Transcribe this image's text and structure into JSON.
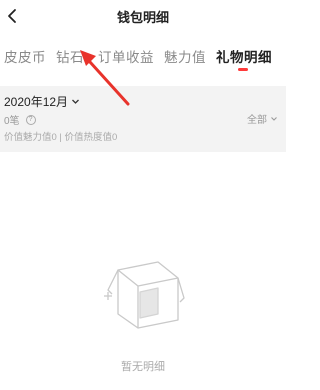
{
  "header": {
    "title": "钱包明细",
    "back_icon": "chevron-left-icon"
  },
  "tabs": [
    {
      "label": "皮皮币"
    },
    {
      "label": "钻石"
    },
    {
      "label": "订单收益"
    },
    {
      "label": "魅力值"
    },
    {
      "label": "礼物明细",
      "active": true
    }
  ],
  "summary": {
    "month": "2020年12月",
    "filter": "全部",
    "amount": "0笔",
    "values_line": "价值魅力值0 | 价值热度值0"
  },
  "empty_state": {
    "text": "暂无明细",
    "icon": "empty-box-icon"
  },
  "colors": {
    "accent": "#ff3a3a",
    "summary_bg": "#f3f3f3",
    "annotation_arrow": "#e8332b"
  }
}
